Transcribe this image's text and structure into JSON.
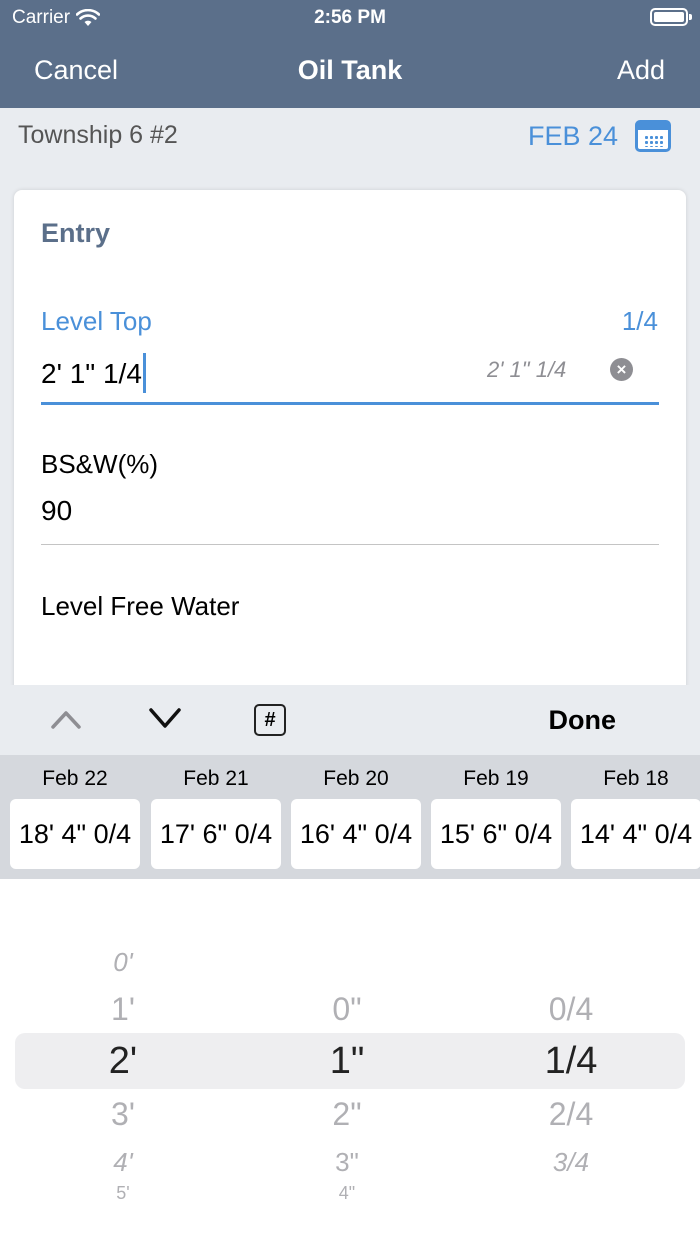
{
  "status": {
    "carrier": "Carrier",
    "time": "2:56 PM"
  },
  "nav": {
    "cancel": "Cancel",
    "title": "Oil Tank",
    "add": "Add"
  },
  "header": {
    "location": "Township 6 #2",
    "date": "FEB 24"
  },
  "form": {
    "section": "Entry",
    "level_top": {
      "label": "Level Top",
      "fraction": "1/4",
      "value": "2' 1\" 1/4",
      "hint": "2' 1\" 1/4"
    },
    "bsw": {
      "label": "BS&W(%)",
      "value": "90"
    },
    "level_free_water": {
      "label": "Level Free Water"
    }
  },
  "toolbar": {
    "hash": "#",
    "done": "Done"
  },
  "history": [
    {
      "date": "Feb 22",
      "value": "18' 4\" 0/4"
    },
    {
      "date": "Feb 21",
      "value": "17' 6\" 0/4"
    },
    {
      "date": "Feb 20",
      "value": "16' 4\" 0/4"
    },
    {
      "date": "Feb 19",
      "value": "15' 6\" 0/4"
    },
    {
      "date": "Feb 18",
      "value": "14' 4\" 0/4"
    }
  ],
  "picker": {
    "feet": [
      "0'",
      "1'",
      "2'",
      "3'",
      "4'",
      "5'"
    ],
    "feet_selected": "2'",
    "inches": [
      "0\"",
      "1\"",
      "2\"",
      "3\"",
      "4\""
    ],
    "inches_selected": "1\"",
    "quarters": [
      "0/4",
      "1/4",
      "2/4",
      "3/4"
    ],
    "quarters_selected": "1/4"
  },
  "colors": {
    "nav": "#5b6f8a",
    "accent": "#4a90d9"
  }
}
